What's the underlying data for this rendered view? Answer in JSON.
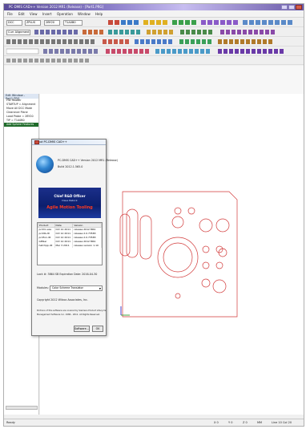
{
  "window": {
    "title": "PC-DMIS CAD++ Version 2012 MR1 (Release) - [Part1.PRG]"
  },
  "menubar": {
    "items": [
      "File",
      "Edit",
      "View",
      "Insert",
      "Operation",
      "Window",
      "Help"
    ]
  },
  "toolbar": {
    "mode_combo": "DCC",
    "workplane_combo": "ZPLUS",
    "probe_combo": "2BY20",
    "tip_combo": "T1A0B0",
    "view_combo": "Curr Alignment"
  },
  "tree": {
    "header": "Edit Window - Part1.PRG",
    "nodes": [
      "File Header",
      "STARTUP = Alignment",
      "Move All DCC Mode",
      "Clearance Plane",
      "Load Probe = 2BY20",
      "TIP = T1A0B0",
      "Add Sphere Features"
    ],
    "selected_index": 6
  },
  "about": {
    "caption": "About PC-DMIS CAD++",
    "product_line": "PC-DMIS CAD++ Version 2012 MR1 (Release)",
    "build_line": "Build 2012.1.565.0",
    "banner_line1": "Chief R&D Officer",
    "banner_line2": "Dave Pellock",
    "banner_line3": "Agile Motion Tooling",
    "columns": [
      "Product",
      "Date",
      "Version"
    ],
    "rows": [
      [
        "pcdlrn.exe",
        "Oct 12 2011",
        "release 2012 MR1"
      ],
      [
        "pcdllb.dll",
        "Oct 12 2011",
        "release 2.0.73583"
      ],
      [
        "pcdfun.dll",
        "Oct 12 2011",
        "release 2.0.73583"
      ],
      [
        "GMSer",
        "Oct 12 2011",
        "release 2012 MR1"
      ],
      [
        "hatchpp.dll",
        "Mar 3 2011",
        "release version 1.10"
      ]
    ],
    "lock_line": "Lock #: 3864 SB Expiration Date: 2016-04-30",
    "modules_label": "Modules:",
    "modules_value": "Color Scheme Translator",
    "copyright_line": "Copyright 2012 Wilcox Associates, Inc.",
    "notice_line1": "Portions of this software are covered by Siemens Product Lifecycle",
    "notice_line2": "Management Software Inc. 1986 - 2011. All Rights Reserved.",
    "software_button": "Software...",
    "ok_button": "OK"
  },
  "statusbar": {
    "ready": "Ready",
    "x": "X 0",
    "y": "Y 0",
    "z": "Z 0",
    "units": "MM",
    "line": "Line 10 Col 20"
  },
  "colors": {
    "part_outline": "#d23a3a",
    "axis_x": "#1a9a1a",
    "axis_y": "#1a1ac8",
    "title_gradient": "#5a4d99",
    "selected_node": "#1f6b2a",
    "banner_bg": "#0c1f6e",
    "banner_accent": "#ff3a1f"
  }
}
